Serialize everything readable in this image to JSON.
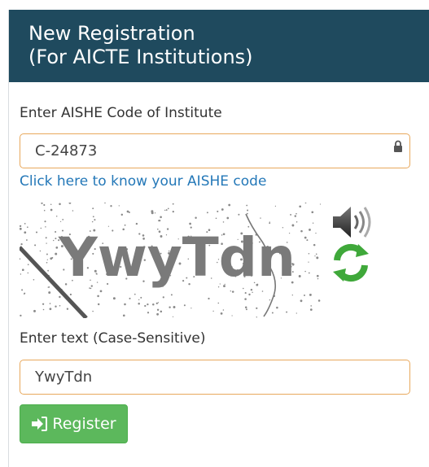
{
  "header": {
    "title_line1": "New Registration",
    "title_line2": "(For AICTE Institutions)"
  },
  "aishe": {
    "label": "Enter AISHE Code of Institute",
    "value": "C-24873",
    "lock_icon": "lock-icon",
    "help_link": "Click here to know your AISHE code"
  },
  "captcha": {
    "text": "YwyTdn",
    "audio_icon": "speaker-icon",
    "refresh_icon": "refresh-icon"
  },
  "captcha_input": {
    "label": "Enter text (Case-Sensitive)",
    "value": "YwyTdn"
  },
  "register": {
    "label": "Register",
    "icon": "sign-in-icon"
  },
  "colors": {
    "header_bg": "#1f4a5e",
    "field_border": "#e8a85c",
    "link": "#2478b8",
    "button_bg": "#5cb85c"
  }
}
